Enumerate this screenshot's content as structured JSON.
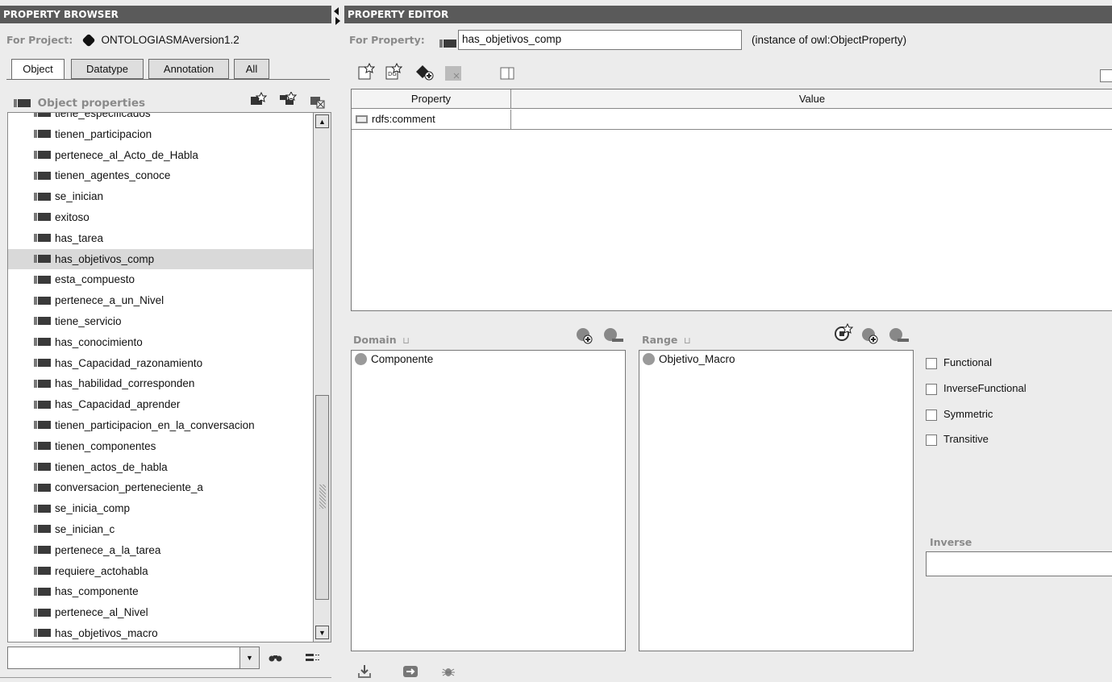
{
  "browser": {
    "title": "PROPERTY BROWSER",
    "project_label": "For Project:",
    "project_name": "ONTOLOGIASMAversion1.2",
    "tabs": [
      {
        "label": "Object",
        "active": true
      },
      {
        "label": "Datatype",
        "active": false
      },
      {
        "label": "Annotation",
        "active": false
      },
      {
        "label": "All",
        "active": false
      }
    ],
    "section_title": "Object properties",
    "partial_top_item": "tiene_especificados",
    "items": [
      {
        "label": "tienen_participacion",
        "selected": false
      },
      {
        "label": "pertenece_al_Acto_de_Habla",
        "selected": false
      },
      {
        "label": "tienen_agentes_conoce",
        "selected": false
      },
      {
        "label": "se_inician",
        "selected": false
      },
      {
        "label": "exitoso",
        "selected": false
      },
      {
        "label": "has_tarea",
        "selected": false
      },
      {
        "label": "has_objetivos_comp",
        "selected": true
      },
      {
        "label": "esta_compuesto",
        "selected": false
      },
      {
        "label": "pertenece_a_un_Nivel",
        "selected": false
      },
      {
        "label": "tiene_servicio",
        "selected": false
      },
      {
        "label": "has_conocimiento",
        "selected": false
      },
      {
        "label": "has_Capacidad_razonamiento",
        "selected": false
      },
      {
        "label": "has_habilidad_corresponden",
        "selected": false
      },
      {
        "label": "has_Capacidad_aprender",
        "selected": false
      },
      {
        "label": "tienen_participacion_en_la_conversacion",
        "selected": false
      },
      {
        "label": "tienen_componentes",
        "selected": false
      },
      {
        "label": "tienen_actos_de_habla",
        "selected": false
      },
      {
        "label": "conversacion_perteneciente_a",
        "selected": false
      },
      {
        "label": "se_inicia_comp",
        "selected": false
      },
      {
        "label": "se_inician_c",
        "selected": false
      },
      {
        "label": "pertenece_a_la_tarea",
        "selected": false
      },
      {
        "label": "requiere_actohabla",
        "selected": false
      },
      {
        "label": "has_componente",
        "selected": false
      },
      {
        "label": "pertenece_al_Nivel",
        "selected": false
      },
      {
        "label": "has_objetivos_macro",
        "selected": false
      }
    ],
    "search_value": ""
  },
  "editor": {
    "title": "PROPERTY EDITOR",
    "property_label": "For Property:",
    "property_name": "has_objetivos_comp",
    "instance_of": "(instance of owl:ObjectProperty)",
    "table_headers": {
      "property": "Property",
      "value": "Value"
    },
    "table_rows": [
      {
        "property": "rdfs:comment",
        "value": ""
      }
    ],
    "domain": {
      "label": "Domain",
      "items": [
        "Componente"
      ]
    },
    "range": {
      "label": "Range",
      "items": [
        "Objetivo_Macro"
      ]
    },
    "characteristics": [
      {
        "label": "Functional",
        "checked": false
      },
      {
        "label": "InverseFunctional",
        "checked": false
      },
      {
        "label": "Symmetric",
        "checked": false
      },
      {
        "label": "Transitive",
        "checked": false
      }
    ],
    "inverse_label": "Inverse",
    "inverse_value": ""
  },
  "colors": {
    "titlebar": "#5a5a5a",
    "selected_row": "#d9d9d9",
    "panel_bg": "#ececec"
  }
}
